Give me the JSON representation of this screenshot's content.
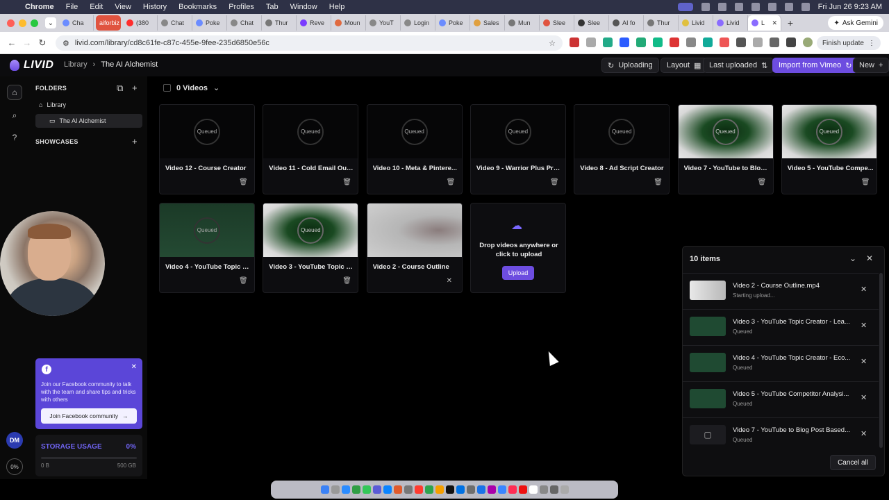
{
  "menubar": {
    "app": "Chrome",
    "items": [
      "File",
      "Edit",
      "View",
      "History",
      "Bookmarks",
      "Profiles",
      "Tab",
      "Window",
      "Help"
    ],
    "datetime": "Fri Jun 26  9:23 AM"
  },
  "tabs": {
    "items": [
      {
        "label": "Cha",
        "color": "#6b8cff"
      },
      {
        "label": "aiforbiz",
        "color": "#e0533f"
      },
      {
        "label": "(380",
        "color": "#ff2d2d"
      },
      {
        "label": "Chat",
        "color": "#888888"
      },
      {
        "label": "Poke",
        "color": "#6b8cff"
      },
      {
        "label": "Chat",
        "color": "#888888"
      },
      {
        "label": "Thur",
        "color": "#777777"
      },
      {
        "label": "Reve",
        "color": "#7a3cff"
      },
      {
        "label": "Moun",
        "color": "#e06a3f"
      },
      {
        "label": "YouT",
        "color": "#888888"
      },
      {
        "label": "Login",
        "color": "#888888"
      },
      {
        "label": "Poke",
        "color": "#6b8cff"
      },
      {
        "label": "Sales",
        "color": "#e0a03f"
      },
      {
        "label": "Mun",
        "color": "#777777"
      },
      {
        "label": "Slee",
        "color": "#e0533f"
      },
      {
        "label": "Slee",
        "color": "#333333"
      },
      {
        "label": "AI fo",
        "color": "#555555"
      },
      {
        "label": "Thur",
        "color": "#777777"
      },
      {
        "label": "Livid",
        "color": "#e0c03f"
      },
      {
        "label": "Livid",
        "color": "#8a6cff"
      }
    ],
    "active_label": "L",
    "ask_gemini": "Ask Gemini"
  },
  "address": {
    "url": "livid.com/library/cd8c61fe-c87c-455e-9fee-235d6850e56c",
    "finish_update": "Finish update"
  },
  "header": {
    "logo": "LIVID",
    "breadcrumb_root": "Library",
    "breadcrumb_sep": "›",
    "breadcrumb_current": "The AI Alchemist",
    "uploading": "Uploading",
    "layout": "Layout",
    "sort": "Last uploaded",
    "import": "Import from Vimeo",
    "new": "New"
  },
  "sidebar": {
    "folders_heading": "FOLDERS",
    "library": "Library",
    "folder": "The AI Alchemist",
    "showcases_heading": "SHOWCASES",
    "fb_text": "Join our Facebook community to talk with the team and share tips and tricks with others",
    "fb_button": "Join Facebook community",
    "storage_label": "STORAGE USAGE",
    "storage_pct": "0%",
    "storage_fraction": 0,
    "storage_used": "0 B",
    "storage_total": "500 GB",
    "avatar": "DM",
    "ring_pct": "0%"
  },
  "library": {
    "count_label": "0 Videos",
    "queued_label": "Queued",
    "row1": [
      {
        "title": "Video 12 - Course Creator",
        "style": "dark"
      },
      {
        "title": "Video 11 - Cold Email Outr...",
        "style": "dark"
      },
      {
        "title": "Video 10 - Meta & Pintere...",
        "style": "dark"
      },
      {
        "title": "Video 9 - Warrior Plus Pro...",
        "style": "dark"
      },
      {
        "title": "Video 8 - Ad Script Creator",
        "style": "dark"
      },
      {
        "title": "Video 7 - YouTube to Blog ...",
        "style": "green"
      },
      {
        "title": "Video 5 - YouTube Compe...",
        "style": "green"
      }
    ],
    "row2": [
      {
        "title": "Video 4 - YouTube Topic C...",
        "style": "green2"
      },
      {
        "title": "Video 3 - YouTube Topic C...",
        "style": "green"
      },
      {
        "title": "Video 2 - Course Outline",
        "style": "grey"
      }
    ],
    "drop_text": "Drop videos anywhere or click to upload",
    "upload_button": "Upload"
  },
  "upload_panel": {
    "title": "10 items",
    "items": [
      {
        "name": "Video 2 - Course Outline.mp4",
        "status": "Starting upload...",
        "thumb": "light"
      },
      {
        "name": "Video 3 - YouTube Topic Creator - Lea...",
        "status": "Queued",
        "thumb": "green"
      },
      {
        "name": "Video 4 - YouTube Topic Creator - Eco...",
        "status": "Queued",
        "thumb": "green"
      },
      {
        "name": "Video 5 - YouTube Competitor Analysi...",
        "status": "Queued",
        "thumb": "green"
      },
      {
        "name": "Video 7 - YouTube to Blog Post Based...",
        "status": "Queued",
        "thumb": "file"
      }
    ],
    "cancel_all": "Cancel all"
  }
}
